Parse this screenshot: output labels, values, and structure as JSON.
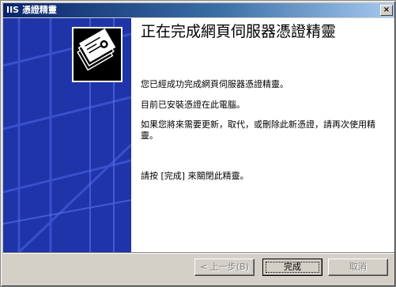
{
  "window": {
    "title": "IIS 憑證精靈",
    "close_symbol": "×"
  },
  "banner": {
    "icon": "certificate-icon",
    "color": "#1f34a8"
  },
  "main": {
    "heading": "正在完成網頁伺服器憑證精靈",
    "paragraphs": [
      "您已經成功完成網頁伺服器憑證精靈。",
      "目前已安裝憑證在此電腦。",
      "如果您將來需要更新，取代，或刪除此新憑證，請再次使用精靈。",
      "請按 [完成] 來關閉此精靈。"
    ]
  },
  "buttons": {
    "back": "< 上一步(B)",
    "finish": "完成",
    "cancel": "取消"
  }
}
